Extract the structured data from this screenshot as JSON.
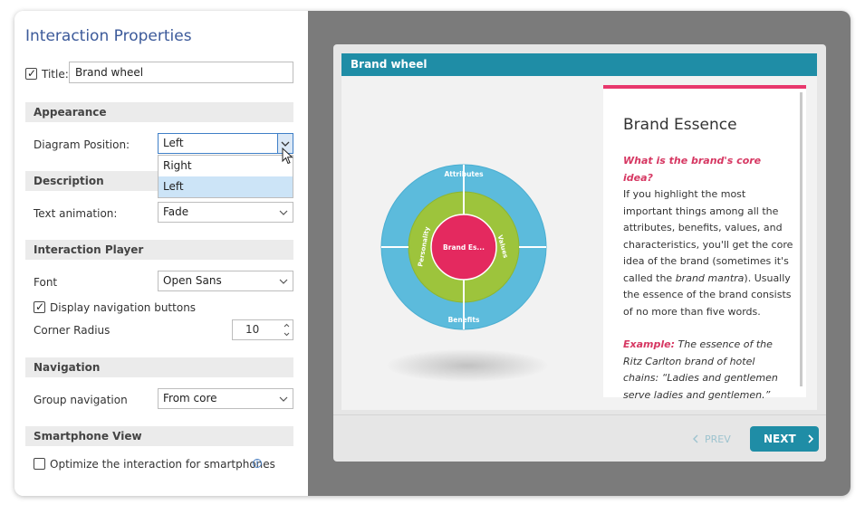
{
  "panel": {
    "title": "Interaction Properties",
    "title_field": {
      "label": "Title:",
      "value": "Brand wheel",
      "checked": true
    }
  },
  "appearance": {
    "header": "Appearance",
    "diagram_position_label": "Diagram Position:",
    "diagram_position_value": "Left",
    "dropdown_options": [
      "Right",
      "Left"
    ]
  },
  "description": {
    "header": "Description",
    "text_animation_label": "Text animation:",
    "text_animation_value": "Fade"
  },
  "interaction_player": {
    "header": "Interaction Player",
    "font_label": "Font",
    "font_value": "Open Sans",
    "display_nav_label": "Display navigation buttons",
    "display_nav_checked": true,
    "corner_radius_label": "Corner Radius",
    "corner_radius_value": "10"
  },
  "navigation": {
    "header": "Navigation",
    "group_nav_label": "Group navigation",
    "group_nav_value": "From core"
  },
  "smartphone": {
    "header": "Smartphone View",
    "optimize_label": "Optimize the interaction for smartphones",
    "optimize_checked": false
  },
  "preview": {
    "title": "Brand wheel",
    "wheel": {
      "center": "Brand Es...",
      "outer_top": "Attributes",
      "outer_bottom": "Benefits",
      "inner_left": "Personality",
      "inner_right": "Values",
      "colors": {
        "outer": "#5cbbdc",
        "inner": "#9dc43c",
        "center": "#e4295f"
      }
    },
    "card": {
      "title": "Brand Essence",
      "question": "What is the brand's core idea?",
      "body_1": "If you highlight the most important things among all the attributes, benefits, values, and characteristics, you'll get the core idea of the brand (sometimes it's called the ",
      "body_em": "brand mantra",
      "body_2": "). Usually the essence of the brand consists of no more than five words.",
      "example_label": "Example:",
      "example_text": " The essence of the Ritz Carlton brand of hotel chains: “Ladies and gentlemen serve ladies and gentlemen.”"
    },
    "nav": {
      "prev": "PREV",
      "next": "NEXT"
    }
  },
  "colors": {
    "accent": "#1f8da6",
    "title_blue": "#3c5a9a",
    "pink": "#e8386d"
  }
}
